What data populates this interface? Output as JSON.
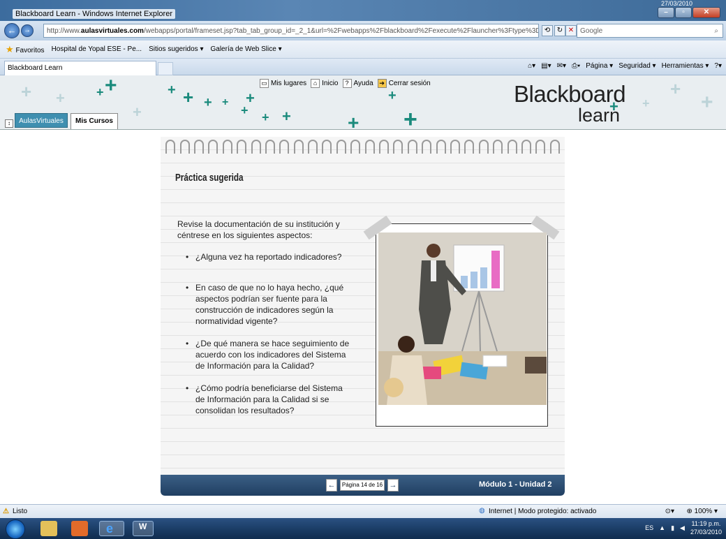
{
  "window": {
    "title": "Blackboard Learn - Windows Internet Explorer",
    "top_date": "27/03/2010"
  },
  "address": {
    "url_prefix": "http://www.",
    "url_domain": "aulasvirtuales.com",
    "url_rest": "/webapps/portal/frameset.jsp?tab_tab_group_id=_2_1&url=%2Fwebapps%2Fblackboard%2Fexecute%2Flauncher%3Ftype%3DCourse%26id%3D_1(",
    "search_placeholder": "Google"
  },
  "favorites": {
    "label": "Favoritos",
    "items": [
      "Hospital de Yopal ESE - Pe...",
      "Sitios sugeridos ▾",
      "Galería de Web Slice ▾"
    ]
  },
  "tabs": {
    "active": "Blackboard Learn"
  },
  "command_bar": {
    "pagina": "Página ▾",
    "seguridad": "Seguridad ▾",
    "herramientas": "Herramientas ▾"
  },
  "bb_header": {
    "links": [
      "Mis lugares",
      "Inicio",
      "Ayuda",
      "Cerrar sesión"
    ],
    "logo_line1": "Blackboard",
    "logo_line2": "learn",
    "tab_aulas": "AulasVirtuales",
    "tab_cursos": "Mis Cursos"
  },
  "lesson": {
    "title": "Práctica sugerida",
    "intro": "Revise la documentación de su institución y céntrese en los siguientes aspectos:",
    "bullets": [
      "¿Alguna vez ha reportado indicadores?",
      "En caso de que no lo haya hecho, ¿qué aspectos podrían ser fuente para la construcción de indicadores según la normatividad vigente?",
      "¿De qué manera se hace seguimiento de acuerdo con los indicadores del Sistema de Información para la Calidad?",
      "¿Cómo podría beneficiarse del Sistema de Información para la Calidad si se consolidan los resultados?"
    ],
    "page_indicator": "Página 14 de 16",
    "module": "Módulo 1 - Unidad 2"
  },
  "status": {
    "left": "Listo",
    "zone": "Internet | Modo protegido: activado",
    "zoom": "100%"
  },
  "taskbar": {
    "lang": "ES",
    "time": "11:19 p.m.",
    "date": "27/03/2010"
  },
  "colors": {
    "accent": "#1a8a7c",
    "footer": "#2b4d72",
    "tab_blue": "#3f8fb0"
  }
}
